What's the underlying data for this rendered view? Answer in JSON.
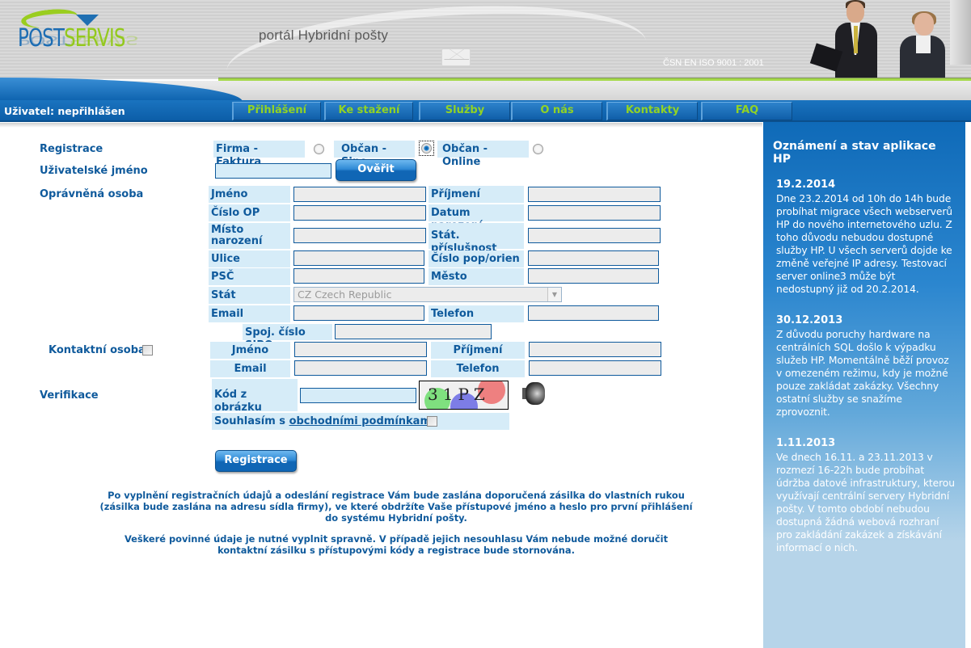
{
  "header": {
    "logo": {
      "part1": "POST",
      "part2": "SERVIS"
    },
    "tagline": "portál  Hybridní pošty",
    "certification": "ČSN EN ISO 9001 : 2001"
  },
  "navbar": {
    "user_status": "Uživatel: nepřihlášen",
    "items": [
      {
        "label": "Přihlášení"
      },
      {
        "label": "Ke stažení"
      },
      {
        "label": "Služby"
      },
      {
        "label": "O nás"
      },
      {
        "label": "Kontakty"
      },
      {
        "label": "FAQ"
      }
    ],
    "accent_color": "#92d324"
  },
  "form": {
    "registration": {
      "label": "Registrace",
      "options": [
        {
          "label": "Firma - Faktura",
          "checked": false
        },
        {
          "label": "Občan - Sipo",
          "checked": true
        },
        {
          "label": "Občan - Online",
          "checked": false
        }
      ]
    },
    "username": {
      "label": "Uživatelské jméno",
      "value": "",
      "verify_button": "Ověřit"
    },
    "authorized_person": {
      "label": "Oprávněná osoba",
      "fields": {
        "first_name": {
          "label": "Jméno",
          "value": ""
        },
        "last_name": {
          "label": "Příjmení",
          "value": ""
        },
        "id_number": {
          "label": "Číslo OP",
          "value": ""
        },
        "birth_date": {
          "label": "Datum narození",
          "value": ""
        },
        "birth_place": {
          "label": "Místo narození",
          "value": ""
        },
        "citizenship": {
          "label": "Stát. příslušnost",
          "value": ""
        },
        "street": {
          "label": "Ulice",
          "value": ""
        },
        "house_number": {
          "label": "Číslo pop/orien",
          "value": ""
        },
        "zip": {
          "label": "PSČ",
          "value": ""
        },
        "city": {
          "label": "Město",
          "value": ""
        },
        "country": {
          "label": "Stát",
          "value": "CZ Czech Republic"
        },
        "email": {
          "label": "Email",
          "value": ""
        },
        "phone": {
          "label": "Telefon",
          "value": ""
        },
        "sipo": {
          "label": "Spoj. číslo SIPO",
          "value": ""
        }
      }
    },
    "contact_person": {
      "label": "Kontaktní osoba",
      "checked": false,
      "fields": {
        "first_name": {
          "label": "Jméno",
          "value": ""
        },
        "last_name": {
          "label": "Příjmení",
          "value": ""
        },
        "email": {
          "label": "Email",
          "value": ""
        },
        "phone": {
          "label": "Telefon",
          "value": ""
        }
      }
    },
    "verification": {
      "label": "Verifikace",
      "code_label": "Kód z obrázku",
      "code_value": "",
      "captcha_text": "31PZ"
    },
    "terms": {
      "prefix": "Souhlasím s ",
      "link": "obchodními podmínkami",
      "checked": false
    },
    "submit_button": "Registrace",
    "notes": [
      "Po vyplnění registračních údajů a odeslání registrace Vám bude zaslána doporučená zásilka do vlastních rukou (zásilka bude zaslána na adresu sídla firmy), ve které obdržíte Vaše přístupové jméno a heslo pro první přihlášení do systému Hybridní pošty.",
      "Veškeré povinné údaje je nutné vyplnit spravně. V případě jejich nesouhlasu Vám nebude možné doručit kontaktní zásilku s přístupovými kódy a registrace bude stornována."
    ]
  },
  "sidebar": {
    "title": "Oznámení a stav aplikace HP",
    "news": [
      {
        "date": "19.2.2014",
        "text": "Dne 23.2.2014 od 10h do 14h bude probíhat migrace všech webserverů HP do nového internetového uzlu. Z toho důvodu nebudou dostupné služby HP. U všech serverů dojde ke změně veřejné IP adresy. Testovací server online3 může být nedostupný již od 20.2.2014."
      },
      {
        "date": "30.12.2013",
        "text": "Z důvodu poruchy hardware na centrálních SQL došlo k výpadku služeb HP. Momentálně běží provoz v omezeném režimu, kdy je možné pouze zakládat zakázky. Všechny ostatní služby se snažíme zprovoznit."
      },
      {
        "date": "1.11.2013",
        "text": "Ve dnech 16.11. a 23.11.2013 v rozmezí 16-22h bude probíhat údržba datové infrastruktury, kterou využívají centrální servery Hybridní pošty. V tomto období nebudou dostupná žádná webová rozhraní pro zakládání zakázek a získávání informací o nich."
      }
    ]
  }
}
